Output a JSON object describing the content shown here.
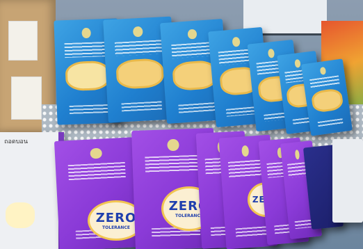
{
  "scene": {
    "description_tags": [
      "stack-of-books",
      "table-display"
    ],
    "zero_text": "ZERO",
    "zero_subtext": "TOLERANCE",
    "left_book_tag": "ถอดบอน"
  },
  "colors": {
    "blue_cover": "#1f7fcf",
    "purple_cover": "#8a3ad7",
    "badge_yellow": "#f4d07a",
    "zero_blue": "#1f3fae"
  }
}
